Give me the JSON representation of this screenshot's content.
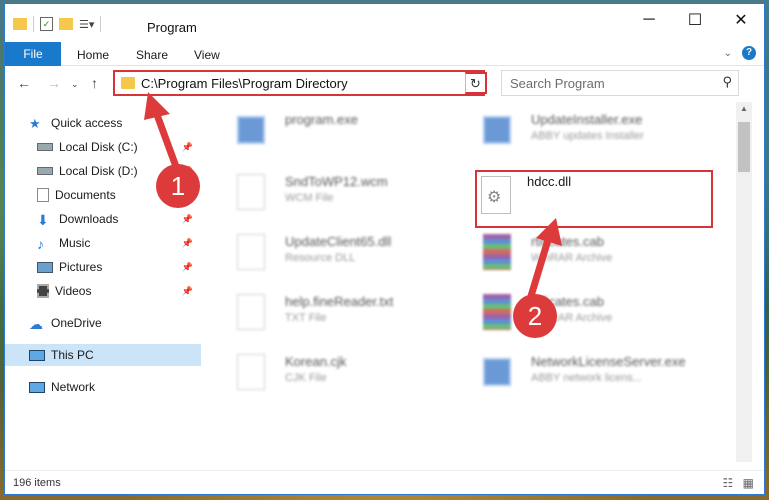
{
  "window": {
    "title": "Program"
  },
  "ribbon": {
    "tabs": [
      "File",
      "Home",
      "Share",
      "View"
    ],
    "help": "?"
  },
  "address": {
    "path": "C:\\Program Files\\Program Directory"
  },
  "search": {
    "placeholder": "Search Program"
  },
  "sidebar": {
    "quick_access": "Quick access",
    "items": [
      "Local Disk (C:)",
      "Local Disk (D:)",
      "Documents",
      "Downloads",
      "Music",
      "Pictures",
      "Videos"
    ],
    "onedrive": "OneDrive",
    "thispc": "This PC",
    "network": "Network"
  },
  "files": {
    "left": [
      {
        "name": "program.exe",
        "type": ""
      },
      {
        "name": "SndToWP12.wcm",
        "type": "WCM File"
      },
      {
        "name": "UpdateClient65.dll",
        "type": "Resource DLL"
      },
      {
        "name": "help.fineReader.txt",
        "type": "TXT File"
      },
      {
        "name": "Korean.cjk",
        "type": "CJK File"
      }
    ],
    "right": [
      {
        "name": "UpdateInstaller.exe",
        "type": "ABBY updates Installer"
      },
      {
        "name": "hdcc.dll",
        "type": ""
      },
      {
        "name": "rtificates.cab",
        "type": "WinRAR Archive"
      },
      {
        "name": "rtificates.cab",
        "type": "WinRAR Archive"
      },
      {
        "name": "NetworkLicenseServer.exe",
        "type": "ABBY network licens..."
      }
    ]
  },
  "status": {
    "count": "196 items"
  },
  "callouts": [
    "1",
    "2"
  ],
  "colors": {
    "accent": "#1979ca",
    "highlight": "#d9333a",
    "badge": "#dd3b3b"
  }
}
